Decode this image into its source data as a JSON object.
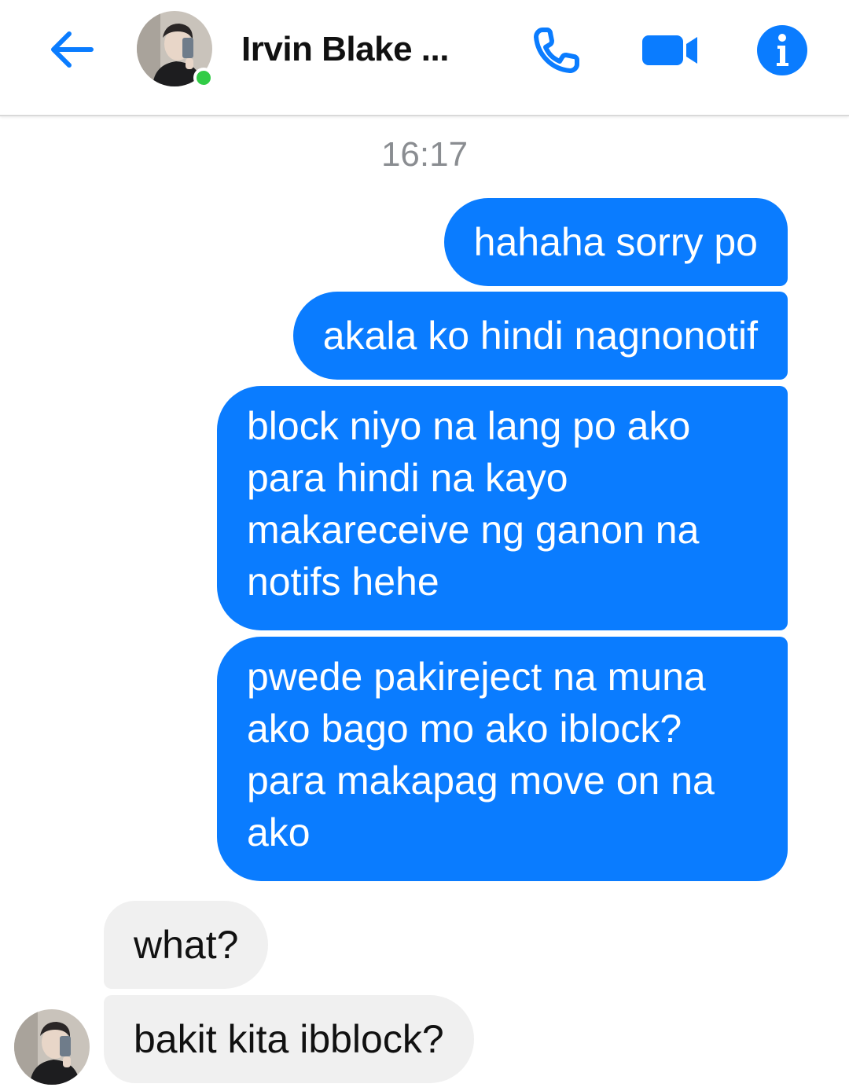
{
  "header": {
    "contact_name": "Irvin Blake ...",
    "online": true,
    "icons": {
      "back": "back-arrow-icon",
      "call": "phone-icon",
      "video": "video-camera-icon",
      "info": "info-icon"
    },
    "accent_color": "#0a7cff"
  },
  "conversation": {
    "timestamp": "16:17",
    "messages": [
      {
        "direction": "outgoing",
        "text": "hahaha sorry po"
      },
      {
        "direction": "outgoing",
        "text": "akala ko hindi nagnonotif"
      },
      {
        "direction": "outgoing",
        "text": "block niyo na lang po ako para hindi na kayo makareceive ng ganon na notifs hehe"
      },
      {
        "direction": "outgoing",
        "text": "pwede pakireject na muna ako bago mo ako iblock? para makapag move on na ako"
      },
      {
        "direction": "incoming",
        "text": "what?"
      },
      {
        "direction": "incoming",
        "text": "bakit kita ibblock?"
      }
    ]
  },
  "colors": {
    "outgoing_bubble": "#0a7cff",
    "incoming_bubble": "#f0f0f0",
    "online_indicator": "#31cc46"
  }
}
